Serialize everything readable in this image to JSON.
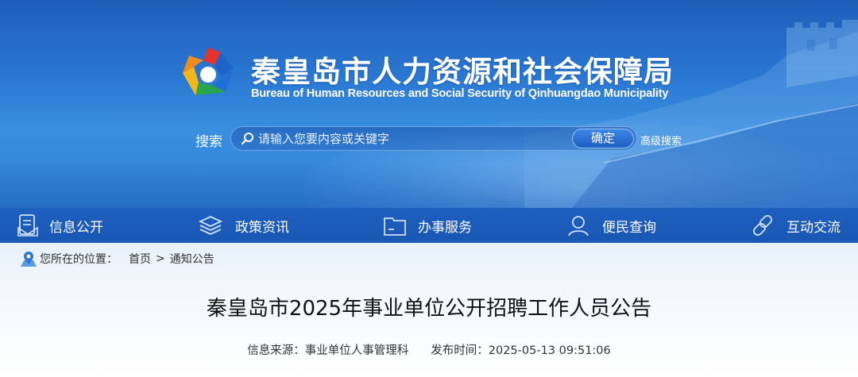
{
  "header": {
    "title_cn": "秦皇岛市人力资源和社会保障局",
    "title_en": "Bureau of Human Resources and Social Security of Qinhuangdao Municipality",
    "logo_icon": "bureau-logo-icon"
  },
  "search": {
    "label": "搜索",
    "placeholder": "请输入您要内容或关键字",
    "button": "确定",
    "advanced": "高级搜索"
  },
  "nav": [
    {
      "label": "信息公开",
      "icon": "document-icon"
    },
    {
      "label": "政策资讯",
      "icon": "layers-icon"
    },
    {
      "label": "办事服务",
      "icon": "folder-icon"
    },
    {
      "label": "便民查询",
      "icon": "person-icon"
    },
    {
      "label": "互动交流",
      "icon": "link-icon"
    }
  ],
  "breadcrumb": {
    "prefix": "您所在的位置：",
    "items": [
      "首页",
      "通知公告"
    ],
    "separator": ">"
  },
  "article": {
    "title": "秦皇岛市2025年事业单位公开招聘工作人员公告",
    "source_label": "信息来源：",
    "source": "事业单位人事管理科",
    "time_label": "发布时间：",
    "time": "2025-05-13 09:51:06"
  },
  "colors": {
    "banner": "#2a78d3",
    "nav": "#1e5fbf",
    "text": "#333333"
  }
}
